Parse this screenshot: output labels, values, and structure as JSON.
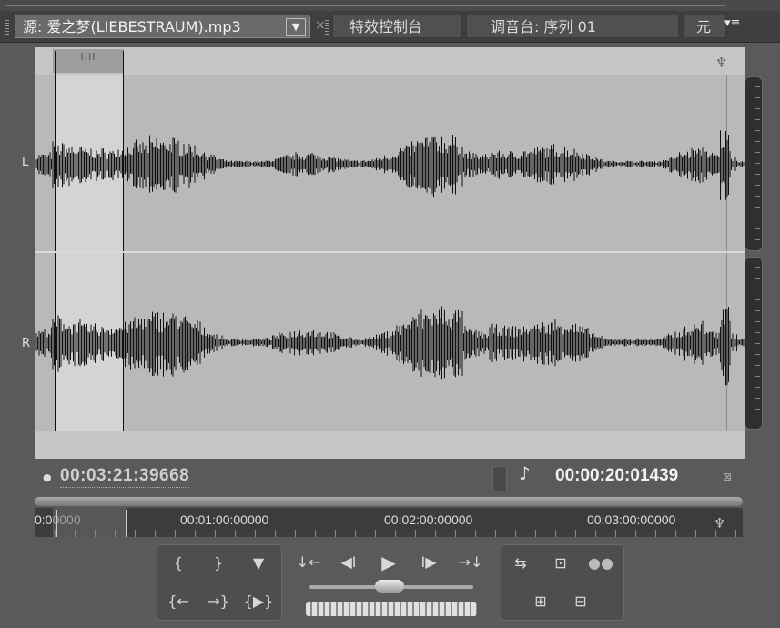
{
  "tabs": {
    "source": "源: 爱之梦(LIEBESTRAUM).mp3",
    "source_dropdown": "▼",
    "close": "×",
    "effects": "特效控制台",
    "mixer": "调音台: 序列 01",
    "meta": "元",
    "menu": "▾≡"
  },
  "waveform": {
    "channel_left": "L",
    "channel_right": "R",
    "handle_grip": "IIII"
  },
  "timecodes": {
    "current_position": "00:03:21:39668",
    "duration": "00:00:20:01439"
  },
  "ruler": {
    "marks": [
      "0:00000",
      "00:01:00:00000",
      "00:02:00:00000",
      "00:03:00:00000"
    ]
  },
  "controls": {
    "mark_in": "{",
    "mark_out": "}",
    "set_marker": "▼",
    "go_to_in": "{←",
    "go_to_out": "→}",
    "play_in_to_out": "{▶}",
    "step_back_marker": "↓←",
    "step_back": "◀I",
    "play": "▶",
    "step_forward": "I▶",
    "step_forward_marker": "→↓",
    "loop": "⇆",
    "safe_margins": "⊡",
    "output": "●●",
    "insert": "⊞",
    "overlay": "⊟"
  },
  "icons": {
    "marker": "♆",
    "note": "♪",
    "expand": "⊠",
    "timeline_end": "♆"
  }
}
